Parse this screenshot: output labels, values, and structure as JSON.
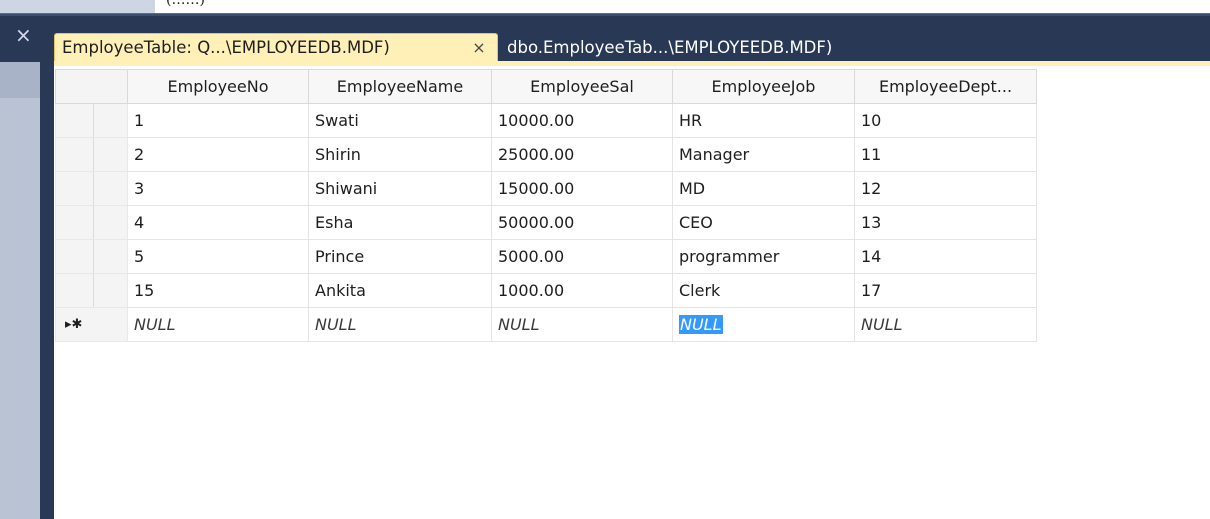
{
  "window": {
    "title_cropped": "(……)"
  },
  "tabs": [
    {
      "label": "EmployeeTable: Q...\\EMPLOYEEDB.MDF)",
      "close_label": "×",
      "active": true
    },
    {
      "label": "dbo.EmployeeTab...\\EMPLOYEEDB.MDF)",
      "active": false
    }
  ],
  "close_all_label": "×",
  "grid": {
    "columns": [
      "EmployeeNo",
      "EmployeeName",
      "EmployeeSal",
      "EmployeeJob",
      "EmployeeDept..."
    ],
    "rows": [
      [
        "1",
        "Swati",
        "10000.00",
        "HR",
        "10"
      ],
      [
        "2",
        "Shirin",
        "25000.00",
        "Manager",
        "11"
      ],
      [
        "3",
        "Shiwani",
        "15000.00",
        "MD",
        "12"
      ],
      [
        "4",
        "Esha",
        "50000.00",
        "CEO",
        "13"
      ],
      [
        "5",
        "Prince",
        "5000.00",
        "programmer",
        "14"
      ],
      [
        "15",
        "Ankita",
        "1000.00",
        "Clerk",
        "17"
      ]
    ],
    "new_row": {
      "marker": "▸✱",
      "values": [
        "NULL",
        "NULL",
        "NULL",
        "NULL",
        "NULL"
      ]
    }
  },
  "colors": {
    "tab_bar": "#293955",
    "active_tab": "#fff0b8",
    "selection": "#3399ff"
  }
}
